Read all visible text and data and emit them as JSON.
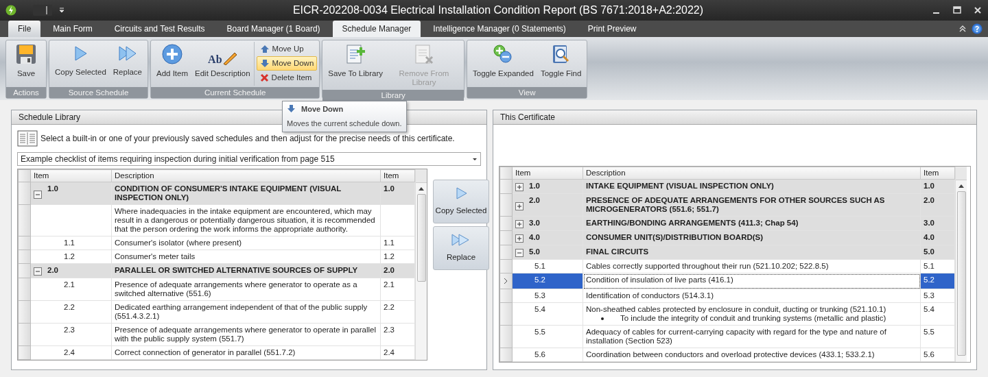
{
  "window": {
    "title": "EICR-202208-0034 Electrical Installation Condition Report (BS 7671:2018+A2:2022)"
  },
  "ribbon_tabs": [
    {
      "label": "File",
      "kind": "menu",
      "selected": false
    },
    {
      "label": "Main Form",
      "kind": "tab",
      "selected": false
    },
    {
      "label": "Circuits and Test Results",
      "kind": "tab",
      "selected": false
    },
    {
      "label": "Board Manager (1 Board)",
      "kind": "tab",
      "selected": false
    },
    {
      "label": "Schedule Manager",
      "kind": "tab",
      "selected": true
    },
    {
      "label": "Intelligence Manager (0 Statements)",
      "kind": "tab",
      "selected": false
    },
    {
      "label": "Print Preview",
      "kind": "tab",
      "selected": false
    }
  ],
  "ribbon_groups": [
    {
      "label": "Actions",
      "buttons": [
        {
          "label": "Save",
          "kind": "large",
          "disabled": false,
          "highlighted": false
        }
      ]
    },
    {
      "label": "Source Schedule",
      "buttons": [
        {
          "label": "Copy Selected",
          "kind": "large",
          "disabled": false,
          "highlighted": false
        },
        {
          "label": "Replace",
          "kind": "large",
          "disabled": false,
          "highlighted": false
        }
      ]
    },
    {
      "label": "Current Schedule",
      "buttons": [
        {
          "label": "Add Item",
          "kind": "large",
          "disabled": false,
          "highlighted": false
        },
        {
          "label": "Edit Description",
          "icon_text": "Ab",
          "kind": "large",
          "disabled": false,
          "highlighted": false
        },
        {
          "label": "Move Up",
          "kind": "small",
          "disabled": false,
          "highlighted": false
        },
        {
          "label": "Move Down",
          "kind": "small",
          "disabled": false,
          "highlighted": true
        },
        {
          "label": "Delete Item",
          "kind": "small",
          "disabled": false,
          "highlighted": false
        }
      ]
    },
    {
      "label": "Library",
      "buttons": [
        {
          "label": "Save To Library",
          "kind": "large",
          "disabled": false,
          "highlighted": false
        },
        {
          "label": "Remove From Library",
          "kind": "large",
          "disabled": true,
          "highlighted": false
        }
      ]
    },
    {
      "label": "View",
      "buttons": [
        {
          "label": "Toggle Expanded",
          "kind": "large",
          "disabled": false,
          "highlighted": false
        },
        {
          "label": "Toggle Find",
          "kind": "large",
          "disabled": false,
          "highlighted": false
        }
      ]
    }
  ],
  "tooltip": {
    "title": "Move Down",
    "text": "Moves the current schedule down."
  },
  "schedule_library": {
    "title": "Schedule Library",
    "instruction": "Select a built-in or one of your previously saved schedules and then adjust for the precise needs of this certificate.",
    "schedule": "Example checklist of items requiring inspection during initial verification from page 515",
    "columns": [
      "Item",
      "Description",
      "Item"
    ],
    "rows": [
      {
        "kind": "group",
        "expanded": true,
        "item": "1.0",
        "description": "CONDITION OF CONSUMER'S INTAKE EQUIPMENT (VISUAL INSPECTION ONLY)",
        "ref": "1.0"
      },
      {
        "kind": "note",
        "description": "Where inadequacies in the intake equipment are encountered, which may result in a dangerous or potentially dangerous situation, it is recommended that the person ordering the work informs the appropriate authority."
      },
      {
        "kind": "item",
        "item": "1.1",
        "description": "Consumer's isolator (where present)",
        "ref": "1.1"
      },
      {
        "kind": "item",
        "item": "1.2",
        "description": "Consumer's meter tails",
        "ref": "1.2"
      },
      {
        "kind": "group",
        "expanded": true,
        "item": "2.0",
        "description": "PARALLEL OR SWITCHED ALTERNATIVE SOURCES OF SUPPLY",
        "ref": "2.0"
      },
      {
        "kind": "item",
        "item": "2.1",
        "description": "Presence of adequate arrangements where generator to operate as a switched alternative (551.6)",
        "ref": "2.1"
      },
      {
        "kind": "item",
        "item": "2.2",
        "description": "Dedicated earthing arrangement independent of that of the public supply (551.4.3.2.1)",
        "ref": "2.2"
      },
      {
        "kind": "item",
        "item": "2.3",
        "description": "Presence of adequate arrangements where generator to operate in parallel with the public supply system (551.7)",
        "ref": "2.3"
      },
      {
        "kind": "item",
        "item": "2.4",
        "description": "Correct connection of generator in parallel (551.7.2)",
        "ref": "2.4"
      }
    ],
    "side_buttons": [
      "Copy Selected",
      "Replace"
    ]
  },
  "certificate": {
    "title": "This Certificate",
    "columns": [
      "Item",
      "Description",
      "Item"
    ],
    "rows": [
      {
        "kind": "group",
        "expanded": false,
        "item": "1.0",
        "description": "INTAKE EQUIPMENT (VISUAL INSPECTION ONLY)",
        "ref": "1.0",
        "selected": false
      },
      {
        "kind": "group",
        "expanded": false,
        "item": "2.0",
        "description": "PRESENCE OF ADEQUATE ARRANGEMENTS FOR OTHER SOURCES SUCH AS MICROGENERATORS (551.6; 551.7)",
        "ref": "2.0",
        "selected": false
      },
      {
        "kind": "group",
        "expanded": false,
        "item": "3.0",
        "description": "EARTHING/BONDING ARRANGEMENTS (411.3; Chap 54)",
        "ref": "3.0",
        "selected": false
      },
      {
        "kind": "group",
        "expanded": false,
        "item": "4.0",
        "description": "CONSUMER UNIT(S)/DISTRIBUTION BOARD(S)",
        "ref": "4.0",
        "selected": false
      },
      {
        "kind": "group",
        "expanded": true,
        "item": "5.0",
        "description": "FINAL CIRCUITS",
        "ref": "5.0",
        "selected": false
      },
      {
        "kind": "item",
        "item": "5.1",
        "description": "Cables correctly supported throughout their run (521.10.202; 522.8.5)",
        "ref": "5.1",
        "selected": false
      },
      {
        "kind": "item",
        "item": "5.2",
        "description": "Condition of insulation of live parts (416.1)",
        "ref": "5.2",
        "selected": true
      },
      {
        "kind": "item",
        "item": "5.3",
        "description": "Identification of conductors (514.3.1)",
        "ref": "5.3",
        "selected": false
      },
      {
        "kind": "item",
        "item": "5.4",
        "description": "Non-sheathed cables protected by enclosure in conduit, ducting or trunking (521.10.1)",
        "bullet": "To include the integrity of conduit and trunking systems (metallic and plastic)",
        "ref": "5.4",
        "selected": false
      },
      {
        "kind": "item",
        "item": "5.5",
        "description": "Adequacy of cables for current-carrying capacity with regard for the type and nature of installation (Section 523)",
        "ref": "5.5",
        "selected": false
      },
      {
        "kind": "item",
        "item": "5.6",
        "description": "Coordination between conductors and overload protective devices (433.1; 533.2.1)",
        "ref": "5.6",
        "selected": false
      }
    ]
  }
}
